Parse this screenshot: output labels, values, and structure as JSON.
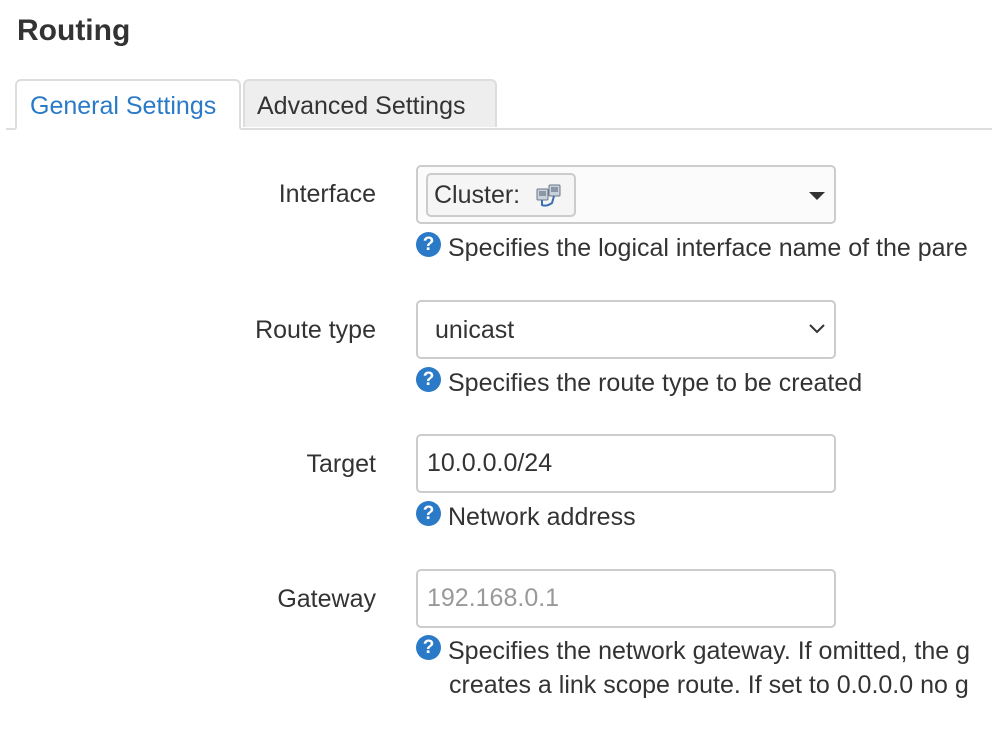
{
  "page": {
    "title": "Routing"
  },
  "tabs": [
    {
      "label": "General Settings",
      "active": true
    },
    {
      "label": "Advanced Settings",
      "active": false
    }
  ],
  "form": {
    "interface": {
      "label": "Interface",
      "chip_label": "Cluster:",
      "chip_icon": "network-interfaces-icon",
      "help": "Specifies the logical interface name of the pare"
    },
    "route_type": {
      "label": "Route type",
      "value": "unicast",
      "help": "Specifies the route type to be created"
    },
    "target": {
      "label": "Target",
      "value": "10.0.0.0/24",
      "help": "Network address"
    },
    "gateway": {
      "label": "Gateway",
      "value": "",
      "placeholder": "192.168.0.1",
      "help_line1": "Specifies the network gateway. If omitted, the g",
      "help_line2": "creates a link scope route. If set to 0.0.0.0 no g"
    }
  },
  "colors": {
    "accent": "#2a7ac7",
    "text": "#333333",
    "border": "#cccccc",
    "tab_inactive_bg": "#eeeeee"
  }
}
